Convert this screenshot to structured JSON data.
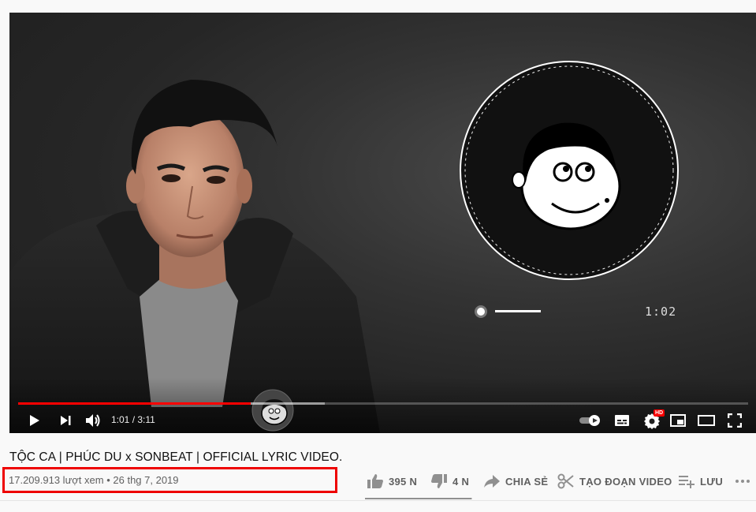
{
  "player": {
    "current_time": "1:01",
    "duration": "3:11",
    "time_text": "1:01 / 3:11",
    "played_fraction": 0.319,
    "buffered_fraction": 0.42,
    "in_video_timer": "1:02",
    "hd_badge": "HD"
  },
  "video": {
    "title": "TỘC CA | PHÚC DU x SONBEAT | OFFICIAL LYRIC VIDEO.",
    "views": "17.209.913 lượt xem",
    "separator": "•",
    "date": "26 thg 7, 2019",
    "meta_text": "17.209.913 lượt xem • 26 thg 7, 2019"
  },
  "actions": {
    "like_count": "395 N",
    "dislike_count": "4 N",
    "share_label": "CHIA SẺ",
    "clip_label": "TẠO ĐOẠN VIDEO",
    "save_label": "LƯU",
    "like_fraction": 0.99
  },
  "colors": {
    "accent_red": "#ff0000",
    "highlight_border": "#e00000",
    "text_primary": "#111111",
    "text_secondary": "#606060"
  },
  "icons": [
    "play-icon",
    "next-icon",
    "volume-icon",
    "autoplay-toggle",
    "subtitles-icon",
    "settings-icon",
    "miniplayer-icon",
    "theater-icon",
    "fullscreen-icon",
    "like-icon",
    "dislike-icon",
    "share-icon",
    "scissors-icon",
    "playlist-add-icon",
    "more-icon"
  ]
}
